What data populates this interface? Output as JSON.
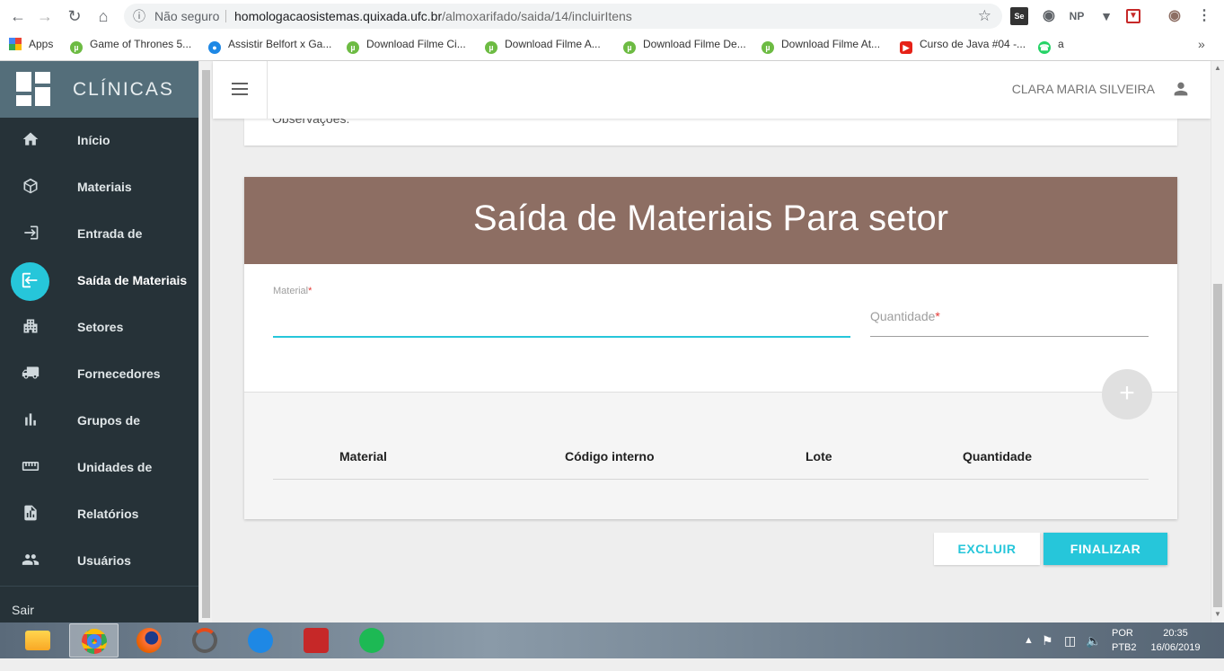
{
  "browser": {
    "security_label": "Não seguro",
    "url_host": "homologacaosistemas.quixada.ufc.br",
    "url_path": "/almoxarifado/saida/14/incluirItens",
    "extensions": [
      "Se",
      "NP"
    ]
  },
  "bookmarks": [
    {
      "label": "Apps",
      "icon": "apps-grid-icon"
    },
    {
      "label": "Game of Thrones 5...",
      "icon": "utorrent-icon"
    },
    {
      "label": "Assistir Belfort x Ga...",
      "icon": "globe-icon"
    },
    {
      "label": "Download Filme Ci...",
      "icon": "utorrent-icon"
    },
    {
      "label": "Download Filme A...",
      "icon": "utorrent-icon"
    },
    {
      "label": "Download Filme De...",
      "icon": "utorrent-icon"
    },
    {
      "label": "Download Filme At...",
      "icon": "utorrent-icon"
    },
    {
      "label": "Curso de Java #04 -...",
      "icon": "youtube-icon"
    },
    {
      "label": "a",
      "icon": "whatsapp-icon"
    }
  ],
  "brand": {
    "title": "CLÍNICAS"
  },
  "sidebar": {
    "items": [
      {
        "label": "Início",
        "icon": "home-icon"
      },
      {
        "label": "Materiais",
        "icon": "cube-icon"
      },
      {
        "label": "Entrada de",
        "icon": "login-icon"
      },
      {
        "label": "Saída de Materiais",
        "icon": "logout-icon",
        "active": true
      },
      {
        "label": "Setores",
        "icon": "building-icon"
      },
      {
        "label": "Fornecedores",
        "icon": "truck-icon"
      },
      {
        "label": "Grupos de",
        "icon": "bar-chart-icon"
      },
      {
        "label": "Unidades de",
        "icon": "ruler-icon"
      },
      {
        "label": "Relatórios",
        "icon": "report-icon"
      },
      {
        "label": "Usuários",
        "icon": "people-icon"
      }
    ],
    "logout_label": "Sair"
  },
  "topbar": {
    "user_name": "CLARA MARIA SILVEIRA"
  },
  "previous_card": {
    "text": "Observações:"
  },
  "form": {
    "title": "Saída de Materiais Para setor",
    "material_label": "Material",
    "quantity_label": "Quantidade",
    "required_mark": "*",
    "add_label": "+"
  },
  "table": {
    "headers": [
      "Material",
      "Código interno",
      "Lote",
      "Quantidade"
    ]
  },
  "actions": {
    "delete_label": "EXCLUIR",
    "finish_label": "FINALIZAR"
  },
  "taskbar": {
    "lang_top": "POR",
    "lang_bottom": "PTB2",
    "time": "20:35",
    "date": "16/06/2019"
  },
  "colors": {
    "accent": "#26c6da",
    "header_brown": "#8d6e63",
    "sidebar_bg": "#263238",
    "brand_bg": "#546e7a"
  }
}
